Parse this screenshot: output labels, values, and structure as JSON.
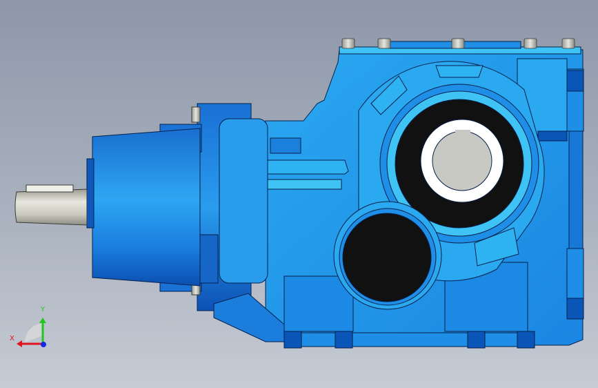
{
  "colors": {
    "background_top": "#8d97a8",
    "background_bottom": "#c6cbd4",
    "housing_blue": "#1e8ee6",
    "housing_light": "#3fc3f5",
    "housing_dark": "#0a55b8",
    "bore_black": "#111111",
    "shaft_gray": "#c8c8c0",
    "edge_line": "#06204a"
  },
  "triad": {
    "x_label": "X",
    "y_label": "Y",
    "x_color": "#e0141e",
    "y_color": "#1ec81e",
    "z_color": "#1428e6"
  }
}
